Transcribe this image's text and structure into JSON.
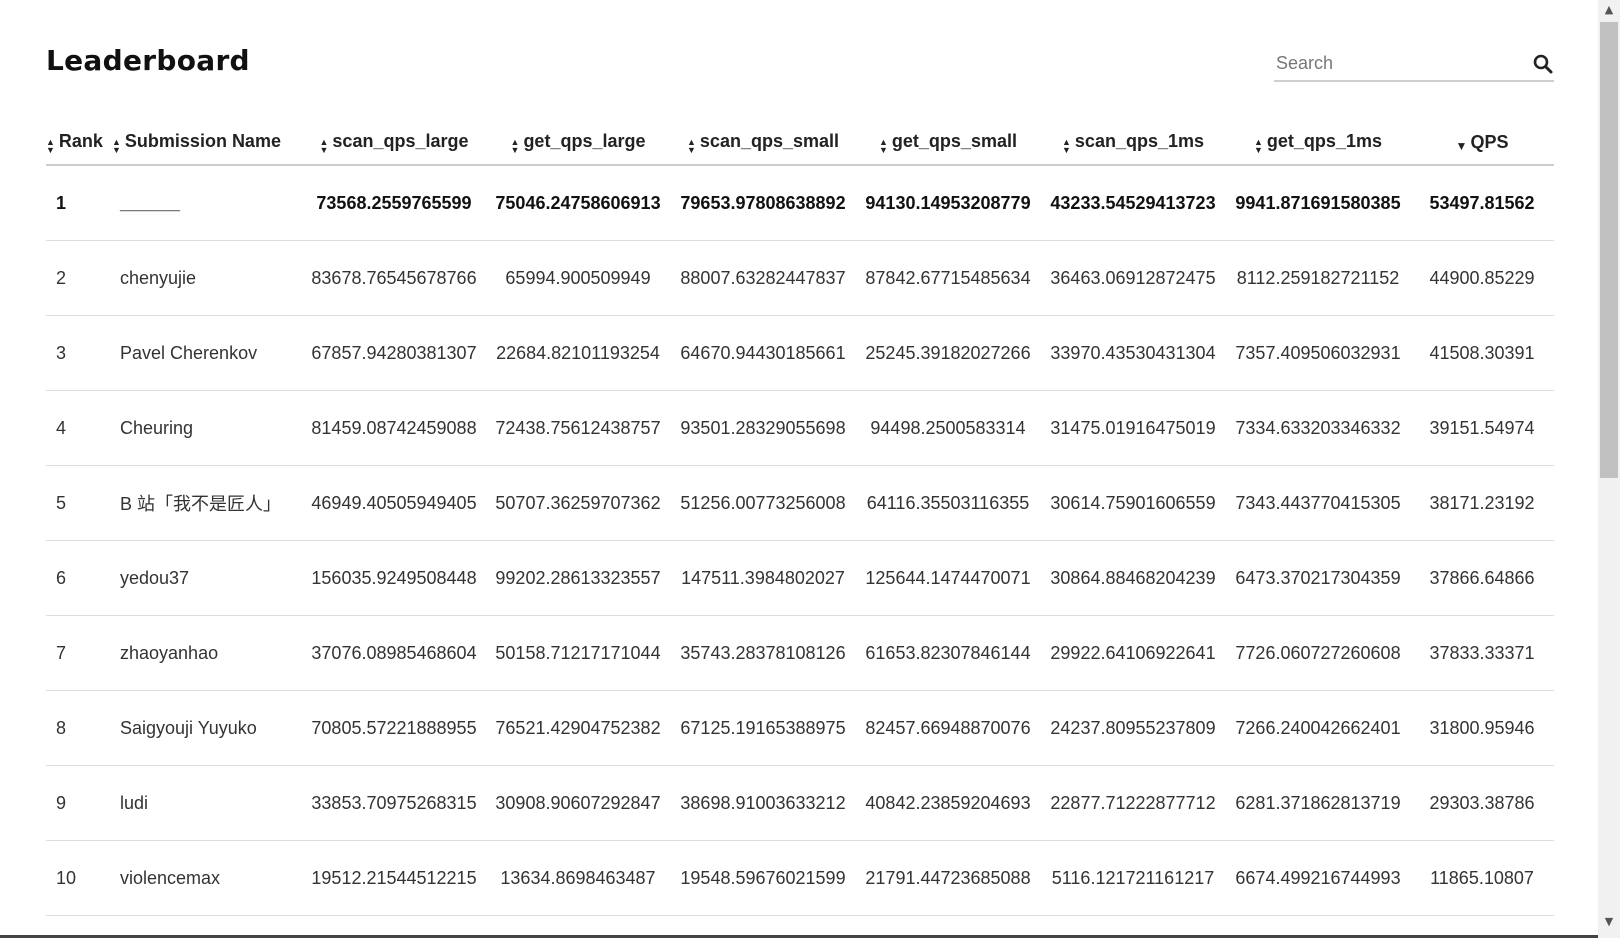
{
  "title": "Leaderboard",
  "search": {
    "placeholder": "Search"
  },
  "columns": [
    "Rank",
    "Submission Name",
    "scan_qps_large",
    "get_qps_large",
    "scan_qps_small",
    "get_qps_small",
    "scan_qps_1ms",
    "get_qps_1ms",
    "QPS"
  ],
  "sort": {
    "column": "QPS",
    "direction": "descending"
  },
  "rows": [
    [
      "1",
      "______",
      "73568.2559765599",
      "75046.24758606913",
      "79653.97808638892",
      "94130.14953208779",
      "43233.54529413723",
      "9941.871691580385",
      "53497.81562"
    ],
    [
      "2",
      "chenyujie",
      "83678.76545678766",
      "65994.900509949",
      "88007.63282447837",
      "87842.67715485634",
      "36463.06912872475",
      "8112.259182721152",
      "44900.85229"
    ],
    [
      "3",
      "Pavel Cherenkov",
      "67857.94280381307",
      "22684.82101193254",
      "64670.94430185661",
      "25245.39182027266",
      "33970.43530431304",
      "7357.409506032931",
      "41508.30391"
    ],
    [
      "4",
      "Cheuring",
      "81459.08742459088",
      "72438.75612438757",
      "93501.28329055698",
      "94498.2500583314",
      "31475.01916475019",
      "7334.633203346332",
      "39151.54974"
    ],
    [
      "5",
      "B 站「我不是匠人」",
      "46949.40505949405",
      "50707.36259707362",
      "51256.00773256008",
      "64116.35503116355",
      "30614.75901606559",
      "7343.443770415305",
      "38171.23192"
    ],
    [
      "6",
      "yedou37",
      "156035.9249508448",
      "99202.28613323557",
      "147511.3984802027",
      "125644.1474470071",
      "30864.88468204239",
      "6473.370217304359",
      "37866.64866"
    ],
    [
      "7",
      "zhaoyanhao",
      "37076.08985468604",
      "50158.71217171044",
      "35743.28378108126",
      "61653.82307846144",
      "29922.64106922641",
      "7726.060727260608",
      "37833.33371"
    ],
    [
      "8",
      "Saigyouji Yuyuko",
      "70805.57221888955",
      "76521.42904752382",
      "67125.19165388975",
      "82457.66948870076",
      "24237.80955237809",
      "7266.240042662401",
      "31800.95946"
    ],
    [
      "9",
      "ludi",
      "33853.70975268315",
      "30908.90607292847",
      "38698.91003633212",
      "40842.23859204693",
      "22877.71222877712",
      "6281.371862813719",
      "29303.38786"
    ],
    [
      "10",
      "violencemax",
      "19512.21544512215",
      "13634.8698463487",
      "19548.59676021599",
      "21791.44723685088",
      "5116.121721161217",
      "6674.499216744993",
      "11865.10807"
    ]
  ]
}
